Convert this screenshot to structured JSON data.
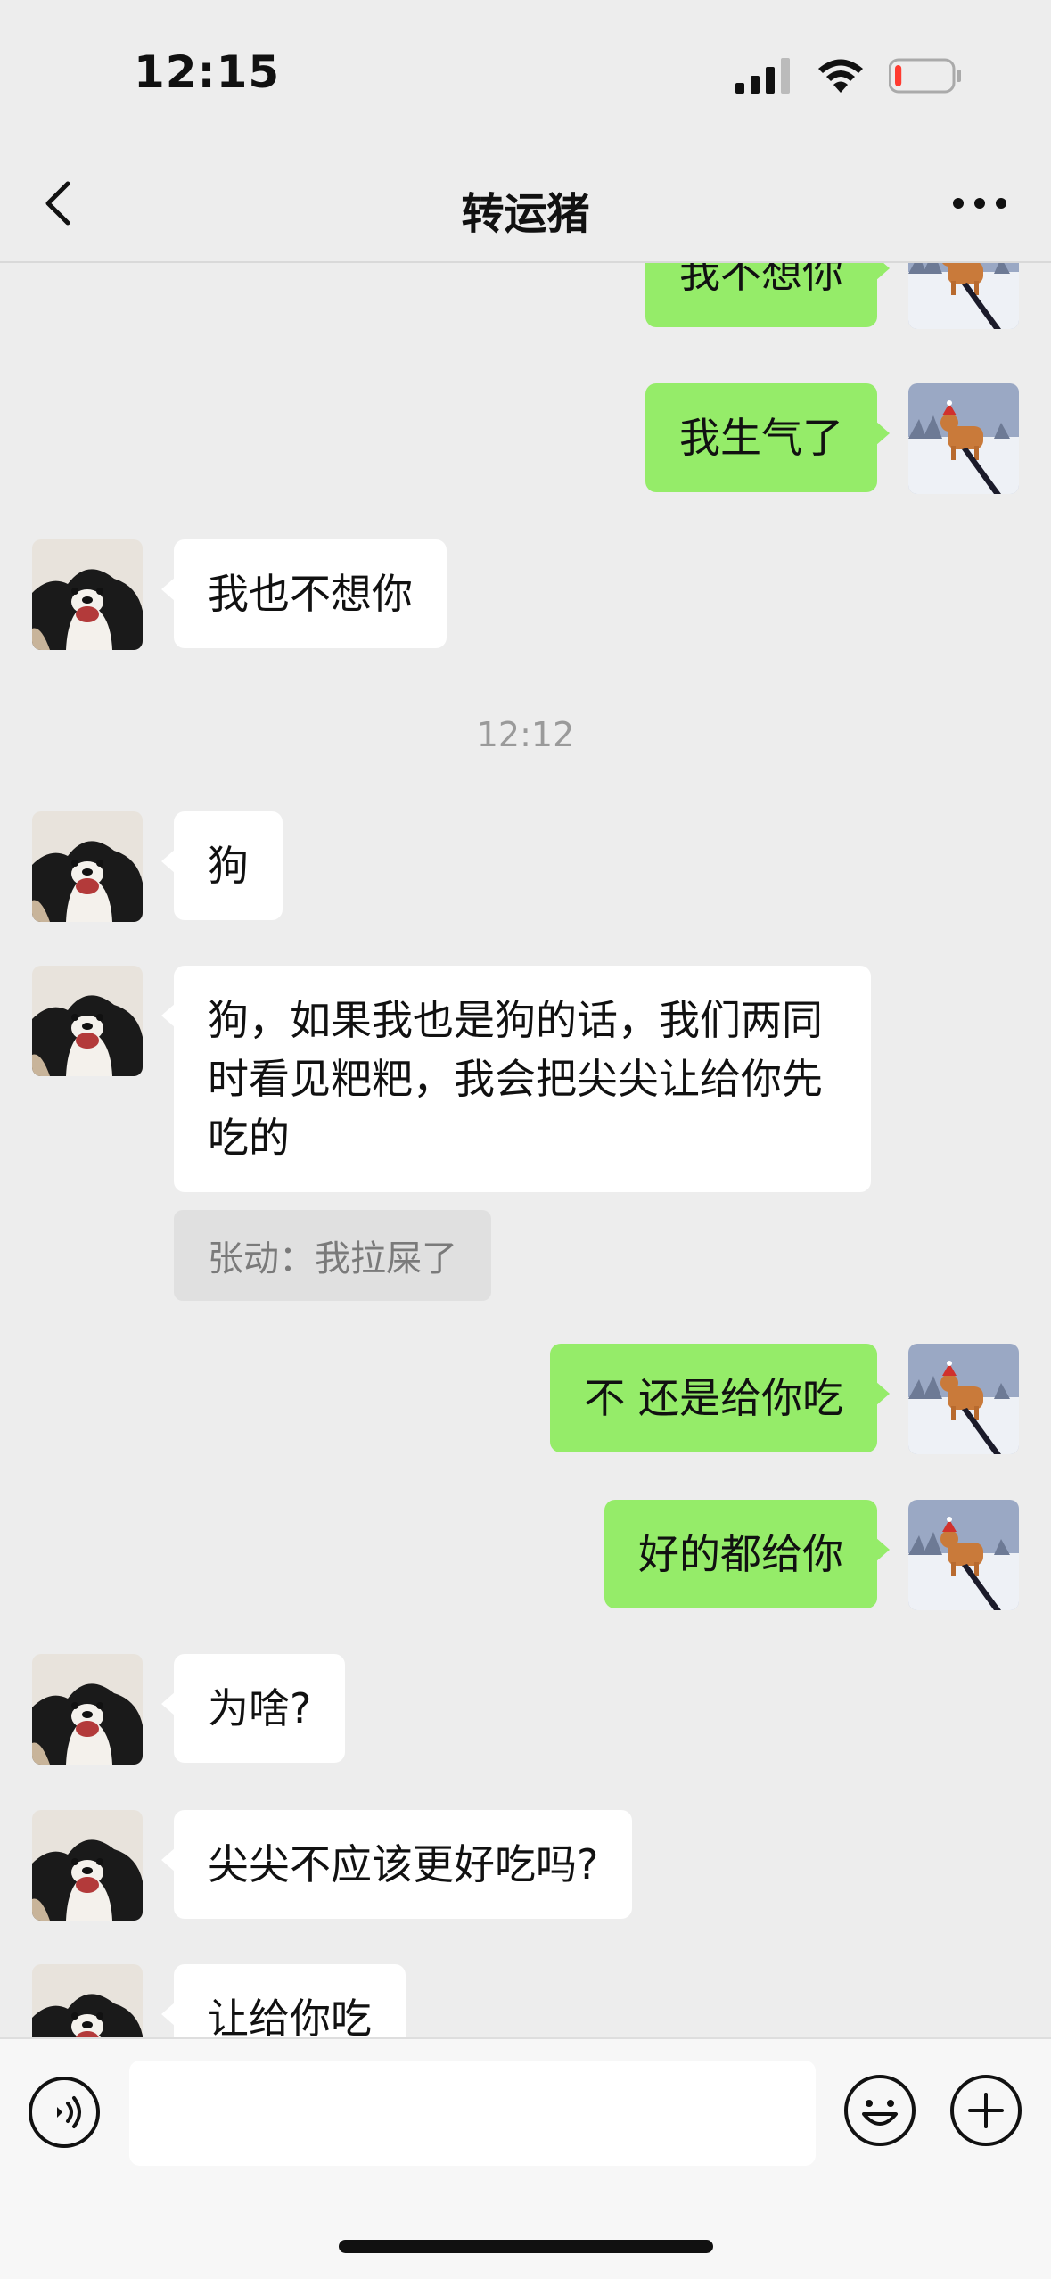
{
  "status_bar": {
    "time": "12:15",
    "battery_level": 0.12
  },
  "nav": {
    "title": "转运猪"
  },
  "messages": {
    "m1": "我不想你",
    "m2": "我生气了",
    "m3": "我也不想你",
    "timestamp": "12:12",
    "m4": "狗",
    "m5": "狗，如果我也是狗的话，我们两同时看见粑粑，我会把尖尖让给你先吃的",
    "quote": "张动：我拉屎了",
    "m6": "不 还是给你吃",
    "m7": "好的都给你",
    "m8": "为啥?",
    "m9": "尖尖不应该更好吃吗?",
    "m10": "让给你吃"
  },
  "input": {
    "value": ""
  },
  "colors": {
    "background": "#ededed",
    "bubble_self": "#95ec69",
    "bubble_other": "#ffffff",
    "battery_low": "#ff3b30"
  },
  "icons": {
    "back": "chevron-left-icon",
    "more": "more-dots-icon",
    "voice": "voice-icon",
    "emoji": "emoji-icon",
    "plus": "plus-icon",
    "signal": "signal-icon",
    "wifi": "wifi-icon",
    "battery": "battery-icon"
  }
}
